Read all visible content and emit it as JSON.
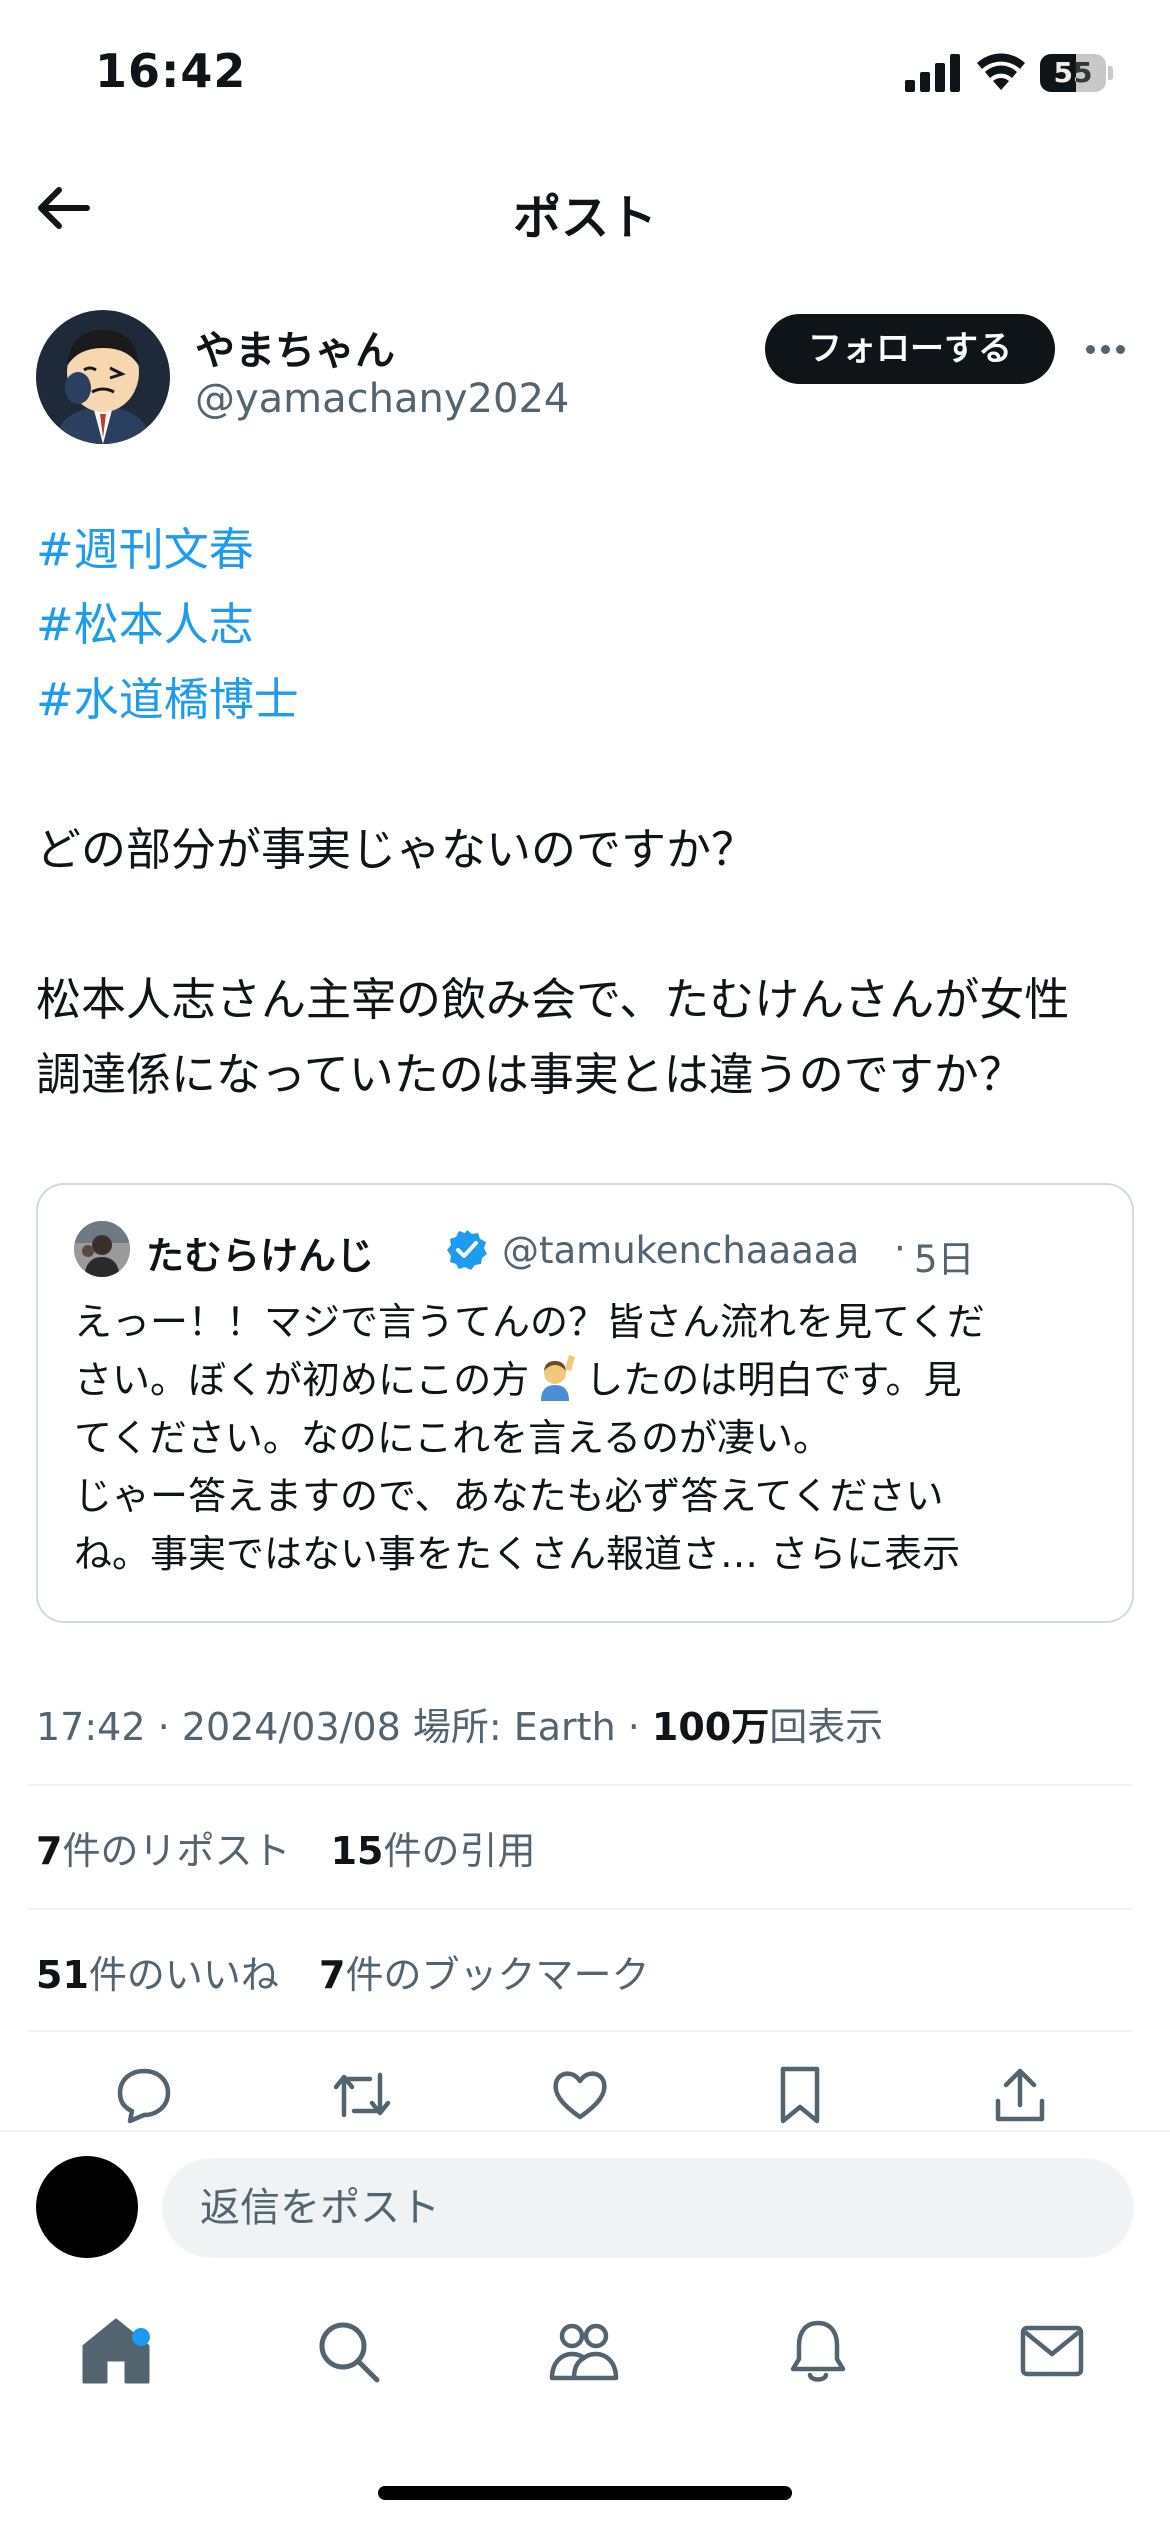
{
  "status_bar": {
    "time": "16:42",
    "battery": "55",
    "battery_level": 0.55
  },
  "header": {
    "title": "ポスト"
  },
  "author": {
    "name": "やまちゃん",
    "handle": "@yamachany2024",
    "follow_label": "フォローする"
  },
  "post": {
    "hashtags": [
      "#週刊文春",
      "#松本人志",
      "#水道橋博士"
    ],
    "line1": "どの部分が事実じゃないのですか？",
    "line2": "松本人志さん主宰の飲み会で、たむけんさんが女性",
    "line3": "調達係になっていたのは事実とは違うのですか？"
  },
  "quote": {
    "name": "たむらけんじ",
    "handle": "@tamukenchaaaaa",
    "separator": "·",
    "time": "5日",
    "lines": [
      "えっー！！マジで言うてんの？皆さん流れを見てくだ",
      "さい。ぼくが初めにこの方",
      "したのは明白です。見",
      "てください。なのにこれを言えるのが凄い。",
      "じゃー答えますので、あなたも必ず答えてください",
      "ね。事実ではない事をたくさん報道さ… "
    ],
    "show_more": "さらに表示"
  },
  "meta": {
    "time": "17:42",
    "sep1": " · ",
    "date": "2024/03/08",
    "location": " 場所: Earth",
    "sep2": " · ",
    "views_number": "100万",
    "views_label": "回表示"
  },
  "stats": {
    "reposts_count": "7",
    "reposts_label": "件のリポスト",
    "quotes_count": "15",
    "quotes_label": "件の引用",
    "likes_count": "51",
    "likes_label": "件のいいね",
    "bookmarks_count": "7",
    "bookmarks_label": "件のブックマーク"
  },
  "reply": {
    "placeholder": "返信をポスト"
  },
  "colors": {
    "accent": "#1d9bf0",
    "text": "#0f1419",
    "secondary": "#536471",
    "border": "#cfd9de"
  }
}
